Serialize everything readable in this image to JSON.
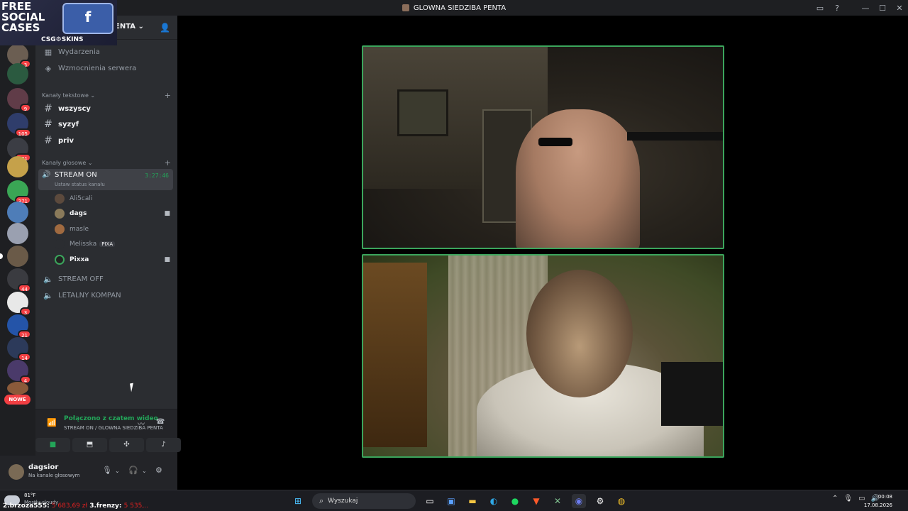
{
  "window": {
    "title": "GLOWNA SIEDZIBA PENTA"
  },
  "promo": {
    "free_text": "FREE SOCIAL CASES",
    "brand": "CSG⚙SKINS"
  },
  "server": {
    "name": "ENTA",
    "menu": {
      "events": "Wydarzenia",
      "boosts": "Wzmocnienia serwera"
    }
  },
  "guild_badges": [
    "3",
    "9",
    "105",
    "121",
    "371",
    "44",
    "3",
    "21",
    "14",
    "4"
  ],
  "guild_new_label": "NOWE",
  "text_category": "Kanały tekstowe",
  "text_channels": [
    "wszyscy",
    "syzyf",
    "priv"
  ],
  "voice_category": "Kanały głosowe",
  "active_voice": {
    "name": "STREAM ON",
    "status": "Ustaw status kanału",
    "timer": "3:27:46"
  },
  "voice_users": [
    {
      "name": "Ali5cali"
    },
    {
      "name": "dags"
    },
    {
      "name": "masle"
    },
    {
      "name": "Melisska",
      "tag": "PIXA"
    },
    {
      "name": "Pixxa"
    }
  ],
  "other_voice": [
    "STREAM OFF",
    "LETALNY KOMPAN"
  ],
  "rtc": {
    "status": "Połączono z czatem wideo",
    "path": "STREAM ON / GLOWNA SIEDZIBA PENTA"
  },
  "user": {
    "name": "dagsior",
    "status": "Na kanale głosowym"
  },
  "taskbar": {
    "weather_temp": "81°F",
    "weather_desc": "Mostly cloudy",
    "ticker_1_label": "2.brzoza555:",
    "ticker_1_value": "5 683,69 zł",
    "ticker_2_label": "3.frenzy:",
    "ticker_2_value": "5 535,..",
    "search_placeholder": "Wyszukaj",
    "time": "00:08",
    "date": "17.08.2026"
  },
  "colors": {
    "accent_green": "#23a559",
    "video_border": "#3ba55c",
    "badge_red": "#f23f43"
  }
}
